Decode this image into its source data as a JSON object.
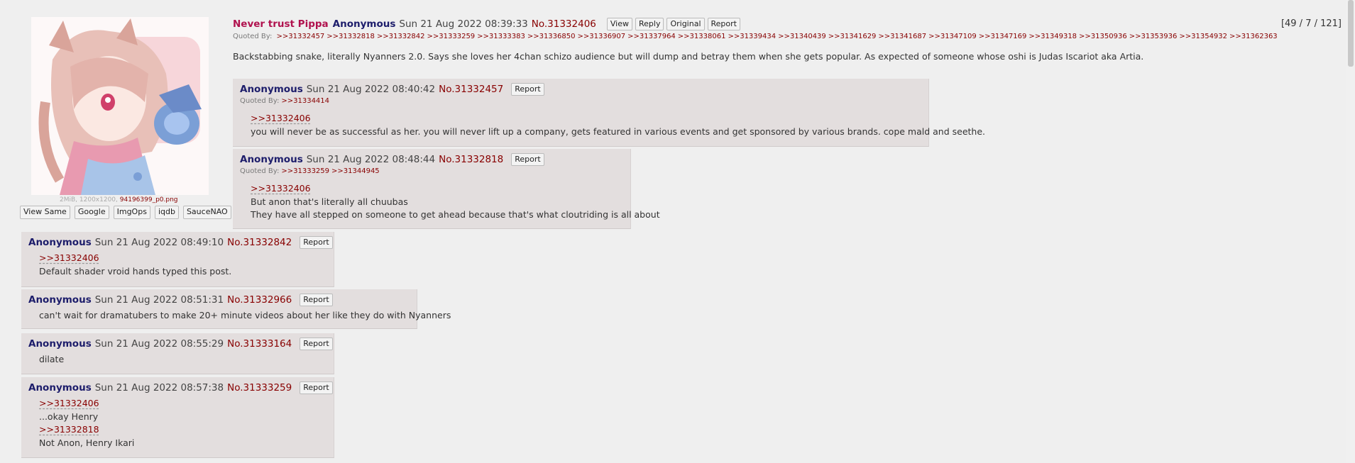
{
  "op": {
    "image_meta": "2MiB, 1200x1200,",
    "image_filename": "94196399_p0.png",
    "image_buttons": [
      "View Same",
      "Google",
      "ImgOps",
      "iqdb",
      "SauceNAO"
    ],
    "download_icon": "download-icon",
    "subject": "Never trust Pippa",
    "name": "Anonymous",
    "date": "Sun 21 Aug 2022 08:39:33",
    "no": "No.31332406",
    "buttons": [
      "View",
      "Reply",
      "Original",
      "Report"
    ],
    "count": "[49 / 7 / 121]",
    "quoted_by_label": "Quoted By:",
    "quoted_by": [
      ">>31332457",
      ">>31332818",
      ">>31332842",
      ">>31333259",
      ">>31333383",
      ">>31336850",
      ">>31336907",
      ">>31337964",
      ">>31338061",
      ">>31339434",
      ">>31340439",
      ">>31341629",
      ">>31341687",
      ">>31347109",
      ">>31347169",
      ">>31349318",
      ">>31350936",
      ">>31353936",
      ">>31354932",
      ">>31362363"
    ],
    "text": "Backstabbing snake, literally Nyanners 2.0. Says she loves her 4chan schizo audience but will dump and betray them when she gets popular. As expected of someone whose oshi is Judas Iscariot aka Artia."
  },
  "replies": [
    {
      "name": "Anonymous",
      "date": "Sun 21 Aug 2022 08:40:42",
      "no": "No.31332457",
      "report": "Report",
      "quoted_by_label": "Quoted By:",
      "quoted_by": [
        ">>31334414"
      ],
      "lines": [
        ">>31332406",
        "you will never be as successful as her. you will never lift up a company, gets featured in various events and get sponsored by various brands. cope mald and seethe."
      ]
    },
    {
      "name": "Anonymous",
      "date": "Sun 21 Aug 2022 08:48:44",
      "no": "No.31332818",
      "report": "Report",
      "quoted_by_label": "Quoted By:",
      "quoted_by": [
        ">>31333259",
        ">>31344945"
      ],
      "lines": [
        ">>31332406",
        "But anon that's literally all chuubas",
        "They have all stepped on someone to get ahead because that's what cloutriding is all about"
      ]
    },
    {
      "name": "Anonymous",
      "date": "Sun 21 Aug 2022 08:49:10",
      "no": "No.31332842",
      "report": "Report",
      "lines": [
        ">>31332406",
        "Default shader vroid hands typed this post."
      ]
    },
    {
      "name": "Anonymous",
      "date": "Sun 21 Aug 2022 08:51:31",
      "no": "No.31332966",
      "report": "Report",
      "lines": [
        "can't wait for dramatubers to make 20+ minute videos about her like they do with Nyanners"
      ]
    },
    {
      "name": "Anonymous",
      "date": "Sun 21 Aug 2022 08:55:29",
      "no": "No.31333164",
      "report": "Report",
      "lines": [
        "dilate"
      ]
    },
    {
      "name": "Anonymous",
      "date": "Sun 21 Aug 2022 08:57:38",
      "no": "No.31333259",
      "report": "Report",
      "lines": [
        ">>31332406",
        "...okay Henry",
        ">>31332818",
        "Not Anon, Henry Ikari"
      ]
    }
  ]
}
